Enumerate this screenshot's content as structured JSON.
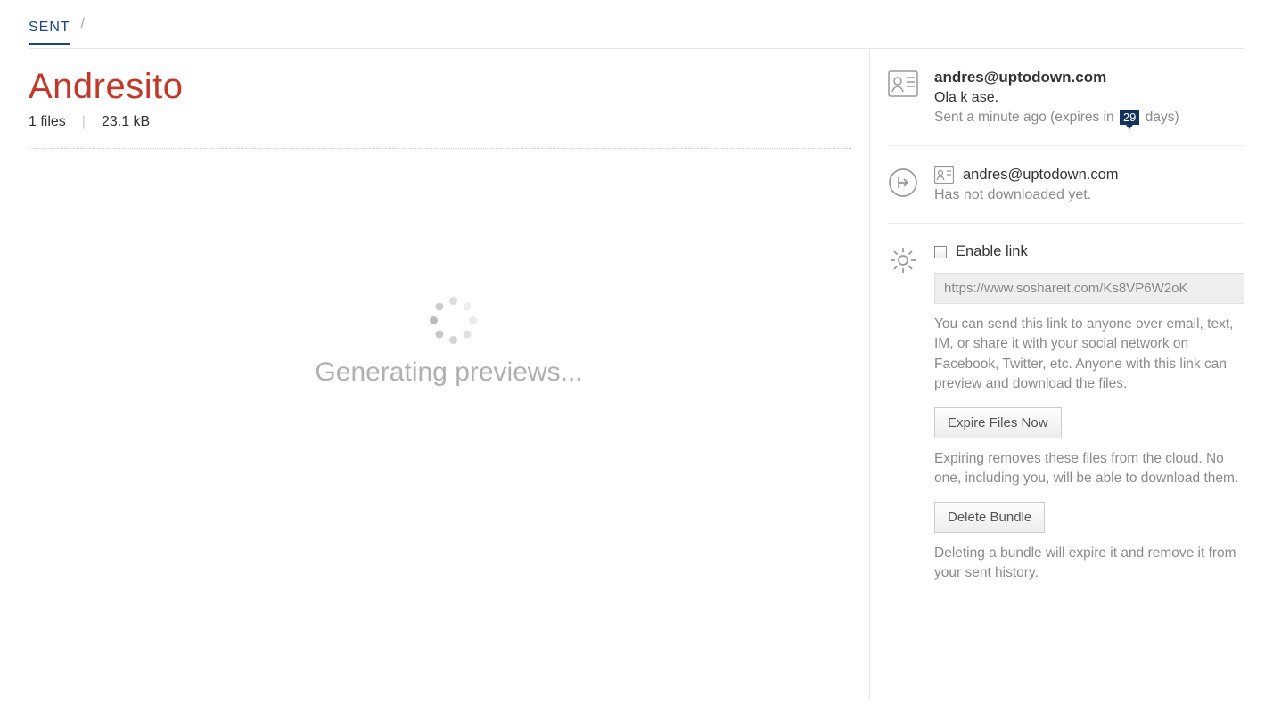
{
  "breadcrumb": {
    "sent": "SENT",
    "sep": "/"
  },
  "bundle": {
    "title": "Andresito",
    "files_count": "1 files",
    "size": "23.1 kB"
  },
  "preview": {
    "status": "Generating previews..."
  },
  "sender": {
    "email": "andres@uptodown.com",
    "message": "Ola k ase.",
    "sent_time": "Sent a minute ago",
    "expires_prefix": "(expires in",
    "expires_days": "29",
    "expires_suffix": "days)"
  },
  "recipient": {
    "email": "andres@uptodown.com",
    "status": "Has not downloaded yet."
  },
  "settings": {
    "enable_link_label": "Enable link",
    "link_url": "https://www.soshareit.com/Ks8VP6W2oK",
    "link_help": "You can send this link to anyone over email, text, IM, or share it with your social network on Facebook, Twitter, etc. Anyone with this link can preview and download the files.",
    "expire_button": "Expire Files Now",
    "expire_help": "Expiring removes these files from the cloud. No one, including you, will be able to download them.",
    "delete_button": "Delete Bundle",
    "delete_help": "Deleting a bundle will expire it and remove it from your sent history."
  }
}
